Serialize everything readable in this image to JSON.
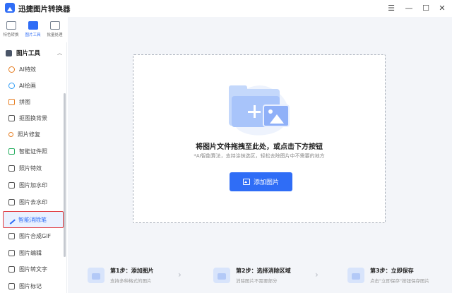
{
  "app": {
    "title": "迅捷图片转换器"
  },
  "window_controls": {
    "menu_icon": "menu-icon",
    "minimize_icon": "minimize-icon",
    "maximize_icon": "maximize-icon",
    "close_icon": "close-icon"
  },
  "mode_tabs": [
    {
      "label": "特色转换",
      "active": false
    },
    {
      "label": "图片工具",
      "active": true
    },
    {
      "label": "批量处理",
      "active": false
    }
  ],
  "sidebar": {
    "section_title": "图片工具",
    "items": [
      {
        "label": "AI特效",
        "icon": "ai-effect-icon",
        "active": false
      },
      {
        "label": "AI绘画",
        "icon": "ai-paint-icon",
        "active": false
      },
      {
        "label": "拼图",
        "icon": "collage-icon",
        "active": false
      },
      {
        "label": "抠图换背景",
        "icon": "cutout-icon",
        "active": false
      },
      {
        "label": "照片修复",
        "icon": "photo-repair-icon",
        "active": false
      },
      {
        "label": "智能证件照",
        "icon": "id-photo-icon",
        "active": false
      },
      {
        "label": "照片特效",
        "icon": "photo-effect-icon",
        "active": false
      },
      {
        "label": "图片加水印",
        "icon": "add-watermark-icon",
        "active": false
      },
      {
        "label": "图片去水印",
        "icon": "remove-watermark-icon",
        "active": false
      },
      {
        "label": "智能消除笔",
        "icon": "eraser-pen-icon",
        "active": true
      },
      {
        "label": "图片合成GIF",
        "icon": "gif-icon",
        "active": false
      },
      {
        "label": "图片编辑",
        "icon": "edit-icon",
        "active": false
      },
      {
        "label": "图片转文字",
        "icon": "ocr-icon",
        "active": false
      },
      {
        "label": "图片标记",
        "icon": "mark-icon",
        "active": false
      }
    ]
  },
  "dropzone": {
    "title": "将图片文件拖拽至此处，或点击下方按钮",
    "subtitle": "*AI智能算法，支持涂抹选区，轻松去除图片中不需要的地方",
    "button_label": "添加图片"
  },
  "steps": [
    {
      "title": "第1步：添加图片",
      "desc": "支持多种格式的图片"
    },
    {
      "title": "第2步：选择消除区域",
      "desc": "消除图片不需要部分"
    },
    {
      "title": "第3步：立即保存",
      "desc": "点击\"立即保存\"按钮保存图片"
    }
  ],
  "colors": {
    "accent": "#2f6df6",
    "highlight_border": "#e0393e"
  }
}
